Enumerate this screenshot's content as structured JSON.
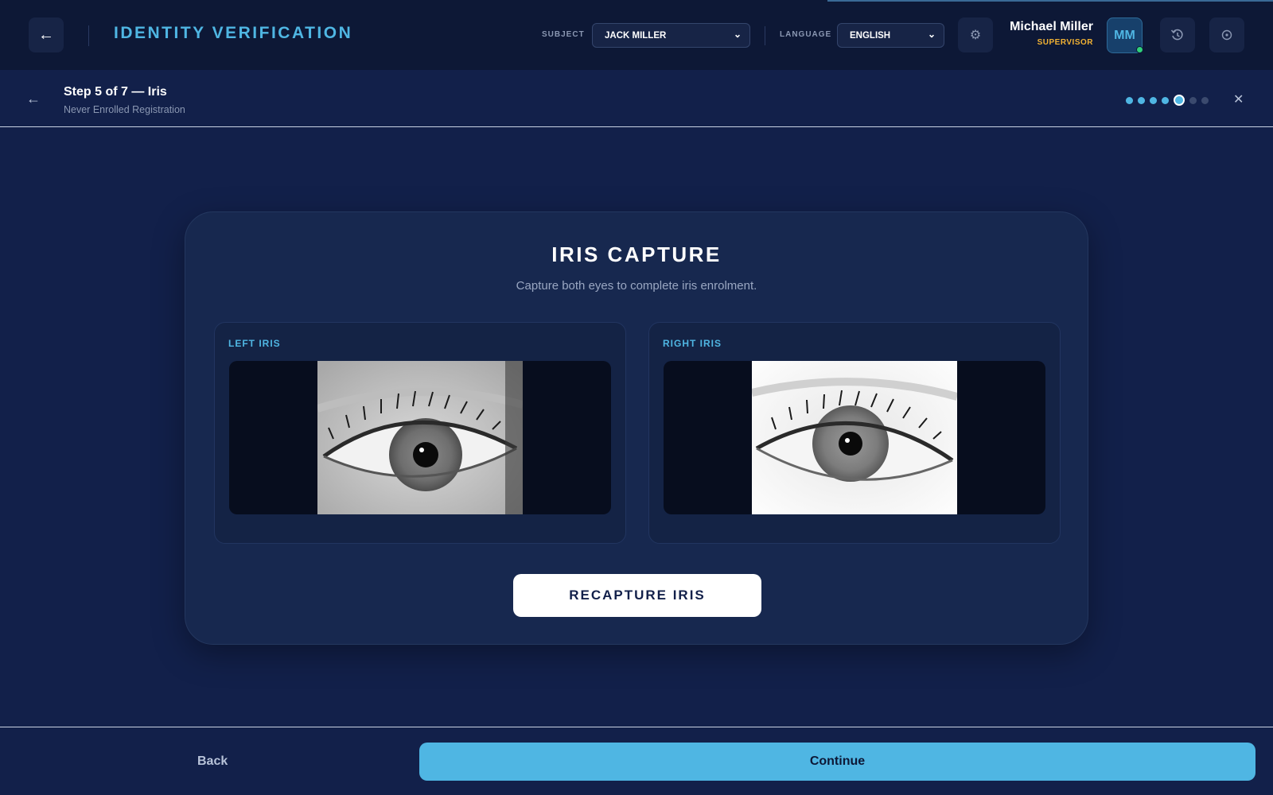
{
  "header": {
    "app_title": "IDENTITY VERIFICATION",
    "subject_label": "SUBJECT",
    "subject_value": "JACK MILLER",
    "language_label": "LANGUAGE",
    "language_value": "ENGLISH",
    "user_name": "Michael Miller",
    "user_role": "SUPERVISOR",
    "user_initials": "MM",
    "icons": [
      "back-arrow-icon",
      "gear-icon",
      "history-icon",
      "power-icon"
    ]
  },
  "step": {
    "title": "Step 5 of 7 — Iris",
    "subtitle": "Never Enrolled Registration",
    "current": 5,
    "total": 7
  },
  "card": {
    "title": "IRIS CAPTURE",
    "subtitle": "Capture both eyes to complete iris enrolment.",
    "left_label": "LEFT IRIS",
    "right_label": "RIGHT IRIS",
    "recapture_label": "RECAPTURE IRIS"
  },
  "footer": {
    "back_label": "Back",
    "continue_label": "Continue"
  },
  "colors": {
    "accent": "#4fb6e3",
    "role": "#f2b233",
    "online": "#2fd17a",
    "background": "#12204a"
  }
}
